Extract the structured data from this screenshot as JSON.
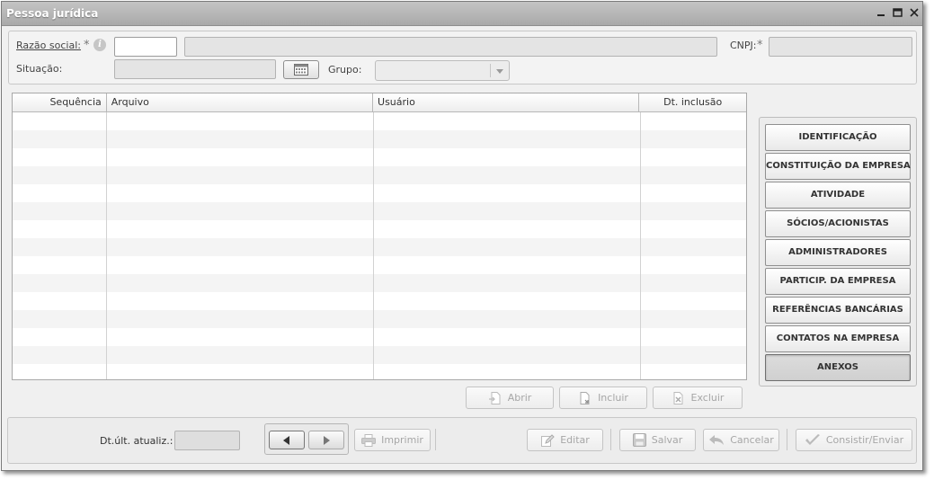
{
  "window": {
    "title": "Pessoa jurídica"
  },
  "form": {
    "razao_label": "Razão social:",
    "required_mark": "*",
    "info_glyph": "i",
    "cnpj_label": "CNPJ:",
    "situacao_label": "Situação:",
    "grupo_label": "Grupo:"
  },
  "grid": {
    "columns": [
      "Sequência",
      "Arquivo",
      "Usuário",
      "Dt. inclusão"
    ],
    "rows": []
  },
  "grid_actions": {
    "open": "Abrir",
    "add": "Incluir",
    "delete": "Excluir"
  },
  "tabs": [
    "IDENTIFICAÇÃO",
    "CONSTITUIÇÃO DA EMPRESA",
    "ATIVIDADE",
    "SÓCIOS/ACIONISTAS",
    "ADMINISTRADORES",
    "PARTICIP. DA EMPRESA",
    "REFERÊNCIAS BANCÁRIAS",
    "CONTATOS NA EMPRESA",
    "ANEXOS"
  ],
  "active_tab": "ANEXOS",
  "footer": {
    "last_update_label": "Dt.últ. atualiz.:",
    "print": "Imprimir",
    "edit": "Editar",
    "save": "Salvar",
    "cancel": "Cancelar",
    "submit": "Consistir/Enviar"
  }
}
